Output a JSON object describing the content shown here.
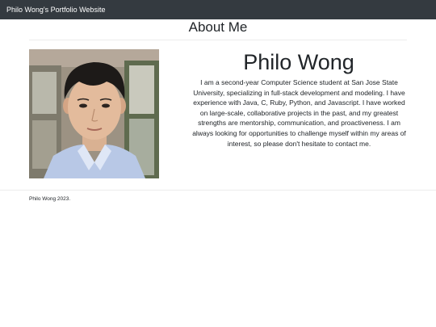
{
  "navbar": {
    "brand": "Philo Wong's Portfolio Website"
  },
  "about": {
    "title": "About Me",
    "name": "Philo Wong",
    "bio": "I am a second-year Computer Science student at San Jose State University, specializing in full-stack development and modeling. I have experience with Java, C,  Ruby, Python, and Javascript. I have worked on large-scale, collaborative projects in the past, and my greatest strengths are mentorship, communication, and proactiveness. I am always looking for opportunities to challenge myself within my areas of interest, so please don't hesitate to contact me."
  },
  "footer": {
    "text": "Philo Wong 2023."
  },
  "colors": {
    "navbar_bg": "#343a40",
    "text": "#212529",
    "divider": "#ececec"
  }
}
